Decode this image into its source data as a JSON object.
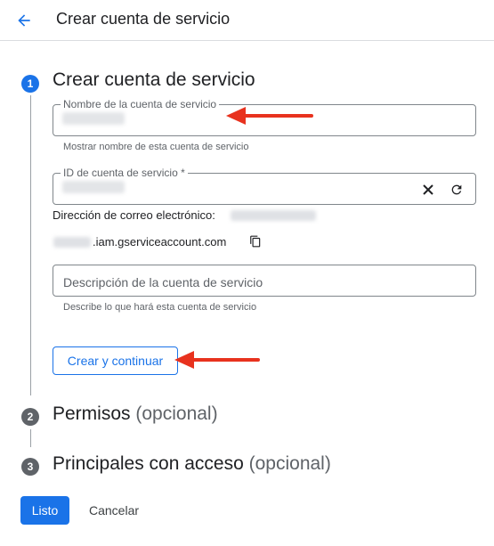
{
  "header": {
    "title": "Crear cuenta de servicio",
    "back_icon": "arrow-back-icon"
  },
  "steps": [
    {
      "number": "1",
      "title": "Crear cuenta de servicio",
      "optional": ""
    },
    {
      "number": "2",
      "title": "Permisos",
      "optional": "(opcional)"
    },
    {
      "number": "3",
      "title": "Principales con acceso",
      "optional": "(opcional)"
    }
  ],
  "form": {
    "name_field": {
      "label": "Nombre de la cuenta de servicio",
      "hint": "Mostrar nombre de esta cuenta de servicio"
    },
    "id_field": {
      "label": "ID de cuenta de servicio *",
      "clear_icon": "close-icon",
      "refresh_icon": "refresh-icon"
    },
    "email": {
      "label": "Dirección de correo electrónico:",
      "suffix": ".iam.gserviceaccount.com",
      "copy_icon": "copy-icon"
    },
    "description_field": {
      "placeholder": "Descripción de la cuenta de servicio",
      "hint": "Describe lo que hará esta cuenta de servicio"
    },
    "create_button": "Crear y continuar"
  },
  "footer": {
    "done_button": "Listo",
    "cancel_button": "Cancelar"
  },
  "colors": {
    "accent": "#1a73e8",
    "annotation_arrow": "#e8321e"
  }
}
